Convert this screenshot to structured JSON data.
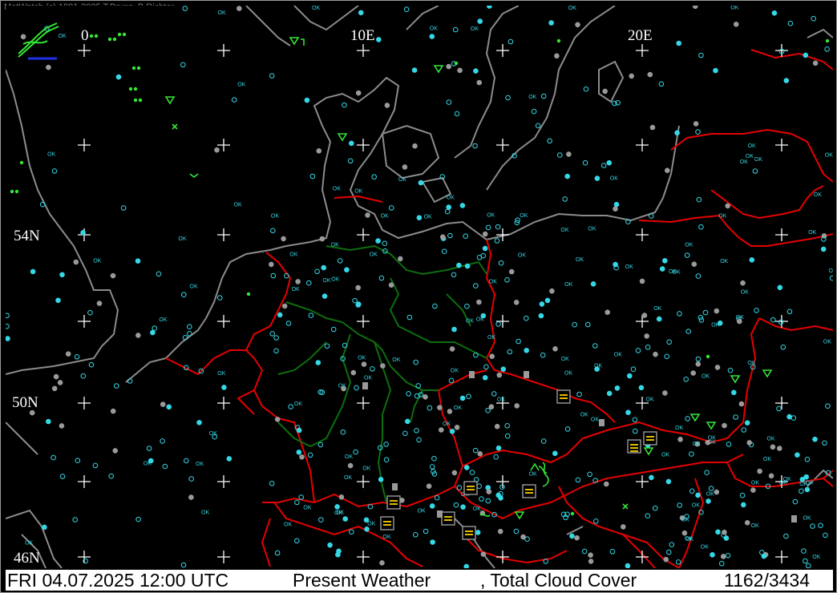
{
  "header": {
    "copyright": "MetWatch (c) 1991-2025 T.Bruns, B.Richter"
  },
  "map": {
    "longitude_labels": [
      "0",
      "10E",
      "20E"
    ],
    "latitude_labels": [
      "54N",
      "50N",
      "46N"
    ]
  },
  "status_bar": {
    "datetime": "FRI 04.07.2025 12:00 UTC",
    "parameter": "Present Weather",
    "parameter2": ", Total Cloud Cover",
    "counter": "1162/3434"
  },
  "colors": {
    "background": "#000000",
    "coastline": "#8c8c8c",
    "country_border": "#e60000",
    "state_border": "#0d6e0d",
    "grid": "#ffffff",
    "station_cloud": "#35d8e6",
    "station_overcast": "#9a9a9a",
    "weather_rain": "#35e635",
    "weather_thunder": "#ffd400"
  },
  "legend_icons": [
    "metwatch-logo-icon"
  ]
}
